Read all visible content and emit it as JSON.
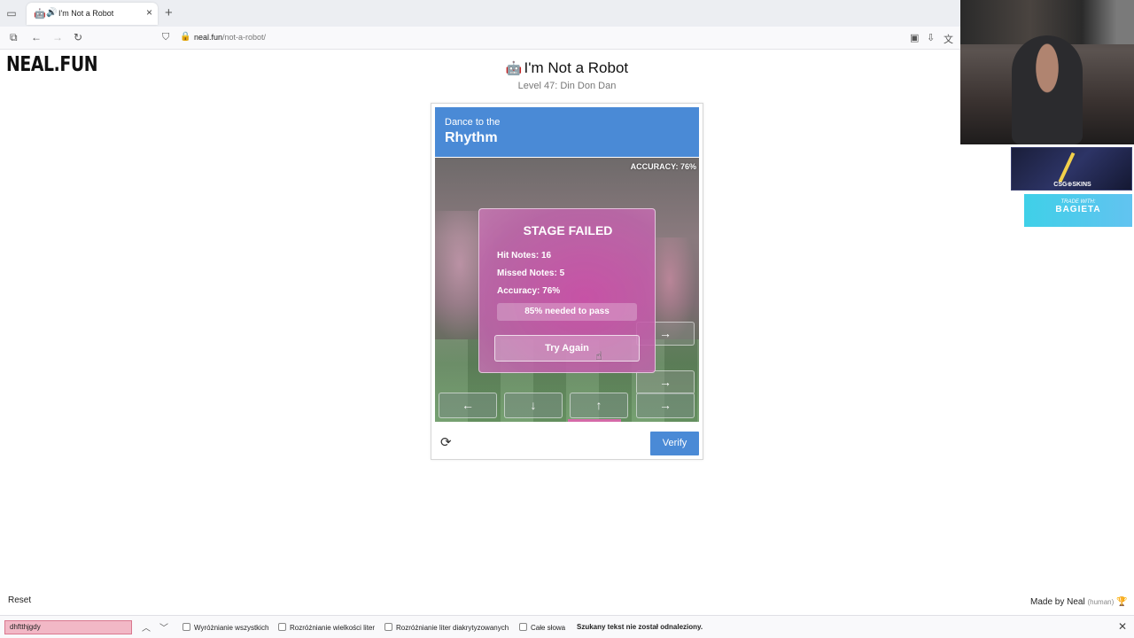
{
  "browser": {
    "tab_title": "I'm Not a Robot",
    "url_host": "neal.fun",
    "url_path": "/not-a-robot/"
  },
  "page": {
    "logo": "NEAL.FUN",
    "title": "I'm Not a Robot",
    "subtitle": "Level 47: Din Don Dan"
  },
  "captcha": {
    "header_small": "Dance to the",
    "header_big": "Rhythm",
    "accuracy_badge": "ACCURACY: 76%",
    "modal": {
      "title": "STAGE FAILED",
      "hit_notes": "Hit Notes: 16",
      "missed_notes": "Missed Notes: 5",
      "accuracy": "Accuracy: 76%",
      "pass_requirement": "85% needed to pass",
      "try_again": "Try Again"
    },
    "keys": [
      "←",
      "↓",
      "↑",
      "→"
    ],
    "falling_notes": [
      "→",
      "→"
    ],
    "verify": "Verify"
  },
  "bottom": {
    "reset": "Reset",
    "made_by": "Made by Neal",
    "human": "(human)"
  },
  "overlays": {
    "banner1_text": "CSG⊕SKINS",
    "banner2_line1": "TRADE WITH:",
    "banner2_line2": "BAGIETA"
  },
  "findbar": {
    "query": "dhftthjgdy",
    "options": [
      "Wyróżnianie wszystkich",
      "Rozróżnianie wielkości liter",
      "Rozróżnianie liter diakrytyzowanych",
      "Całe słowa"
    ],
    "status": "Szukany tekst nie został odnaleziony."
  },
  "colors": {
    "accent_blue": "#4a8ad6",
    "modal_pink": "#cd50aa",
    "find_not_found": "#f2b8c6"
  }
}
